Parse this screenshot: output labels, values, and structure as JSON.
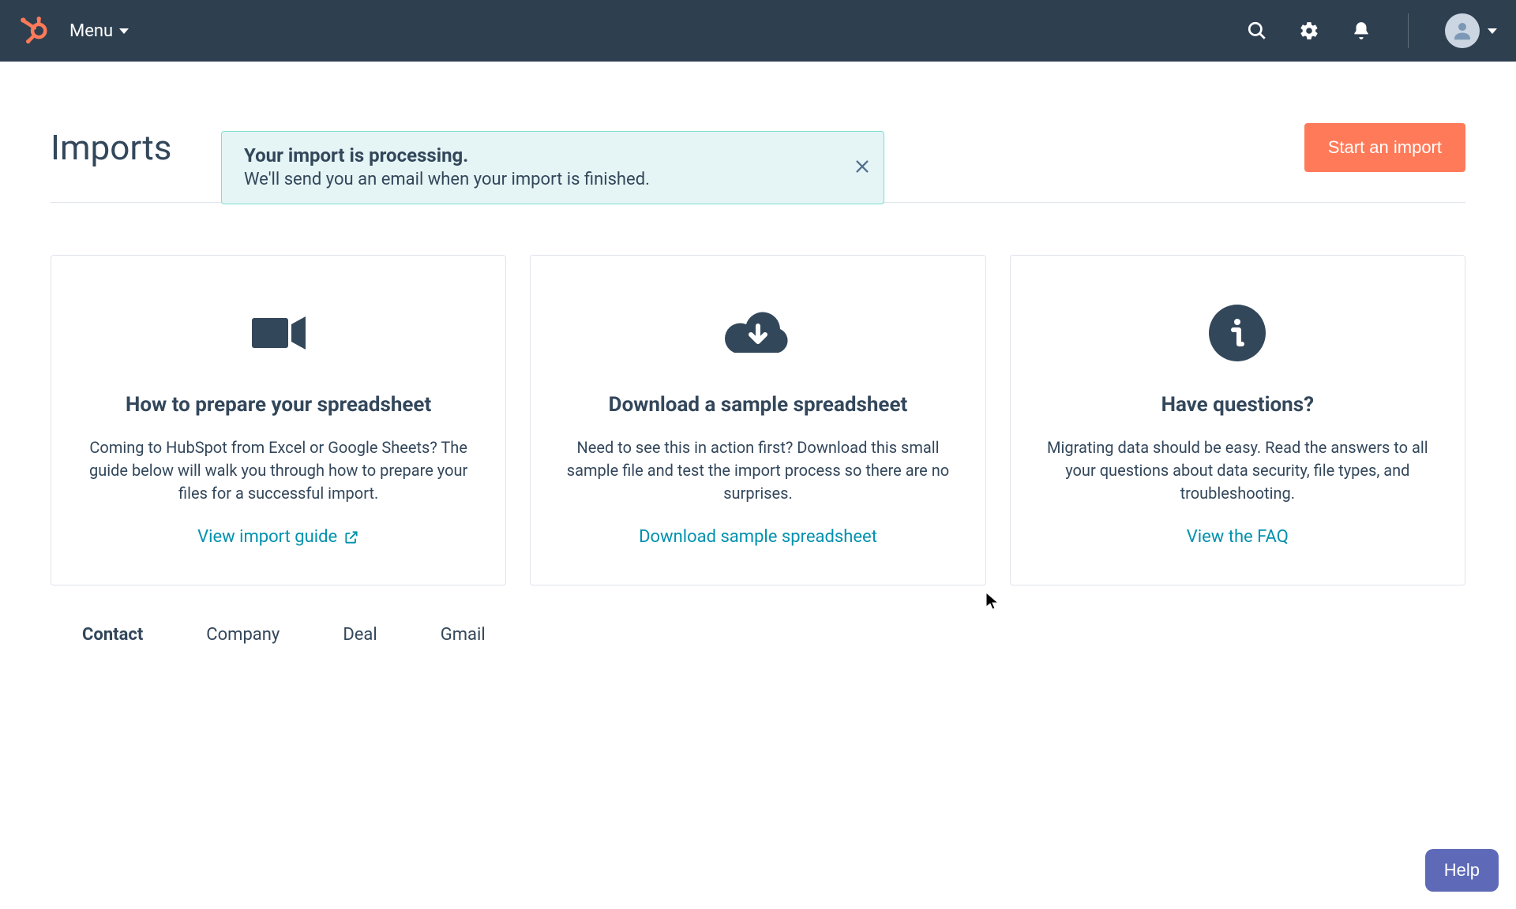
{
  "nav": {
    "menu_label": "Menu"
  },
  "alert": {
    "title": "Your import is processing.",
    "subtitle": "We'll send you an email when your import is finished."
  },
  "page": {
    "title": "Imports",
    "primary_button": "Start an import"
  },
  "cards": [
    {
      "title": "How to prepare your spreadsheet",
      "desc": "Coming to HubSpot from Excel or Google Sheets? The guide below will walk you through how to prepare your files for a successful import.",
      "link_label": "View import guide"
    },
    {
      "title": "Download a sample spreadsheet",
      "desc": "Need to see this in action first? Download this small sample file and test the import process so there are no surprises.",
      "link_label": "Download sample spreadsheet"
    },
    {
      "title": "Have questions?",
      "desc": "Migrating data should be easy. Read the answers to all your questions about data security, file types, and troubleshooting.",
      "link_label": "View the FAQ"
    }
  ],
  "tabs": [
    "Contact",
    "Company",
    "Deal",
    "Gmail"
  ],
  "help": {
    "label": "Help"
  },
  "colors": {
    "nav_bg": "#2e3f50",
    "primary": "#ff7a59",
    "link": "#0091ae",
    "alert_bg": "#e5f5f5",
    "help_bg": "#5e6ab8"
  }
}
